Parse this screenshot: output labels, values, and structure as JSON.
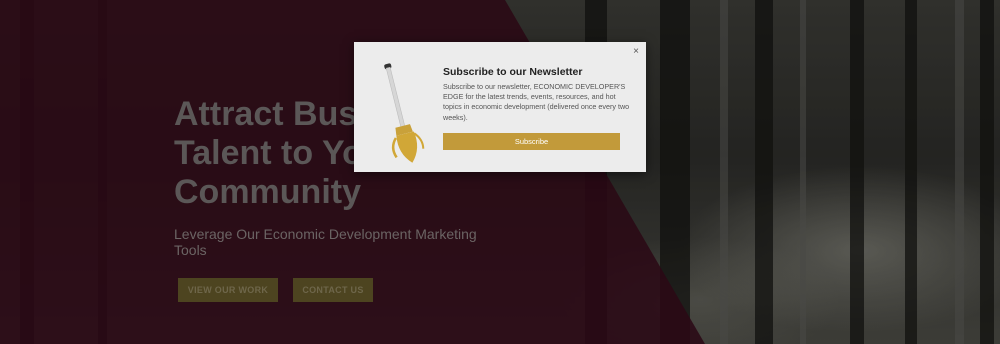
{
  "hero": {
    "title_lines": [
      "Attract Busi",
      "Talent to Yo",
      "Community"
    ],
    "subtitle": "Leverage Our Economic Development Marketing Tools",
    "buttons": {
      "work": "VIEW OUR WORK",
      "contact": "CONTACT US"
    }
  },
  "modal": {
    "close_label": "×",
    "title": "Subscribe to our Newsletter",
    "description": "Subscribe to our newsletter, ECONOMIC DEVELOPER'S EDGE for the latest trends, events, resources, and hot topics in economic development (delivered once every two weeks).",
    "subscribe_label": "Subscribe",
    "icon": "shovel-icon"
  },
  "colors": {
    "overlay": "#340a1a",
    "accent": "#c29a3a",
    "modal_bg": "#ececec"
  }
}
